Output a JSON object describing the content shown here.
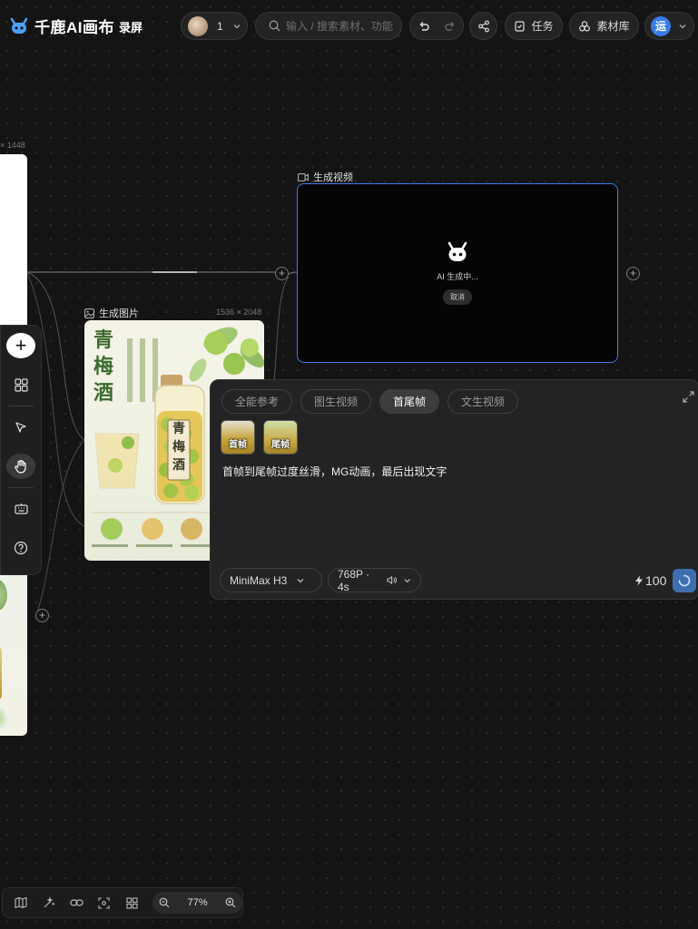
{
  "app": {
    "title": "千鹿AI画布",
    "record_label": "录屏"
  },
  "header": {
    "collaborators_count": "1",
    "search": {
      "placeholder": "输入 / 搜索素材、功能"
    },
    "tasks_label": "任务",
    "library_label": "素材库",
    "account_initial": "运"
  },
  "canvas": {
    "left_card_size": "× 1448",
    "video_node": {
      "label": "生成视频",
      "status": "AI 生成中...",
      "cancel_label": "取消"
    },
    "image_node": {
      "label": "生成图片",
      "size": "1536 × 2048",
      "poster_title": "青梅酒",
      "bottle_label": "青梅酒"
    }
  },
  "panel": {
    "tabs": [
      {
        "label": "全能参考",
        "active": false
      },
      {
        "label": "图生视频",
        "active": false
      },
      {
        "label": "首尾帧",
        "active": true
      },
      {
        "label": "文生视频",
        "active": false
      }
    ],
    "first_frame_label": "首帧",
    "last_frame_label": "尾帧",
    "prompt": "首帧到尾帧过度丝滑，MG动画，最后出现文字",
    "model": "MiniMax H3",
    "settings": "768P · 4s",
    "credits": "100"
  },
  "footer": {
    "zoom": "77%"
  },
  "colors": {
    "accent": "#3b7fe0",
    "background": "#141414",
    "panel": "#232323"
  }
}
